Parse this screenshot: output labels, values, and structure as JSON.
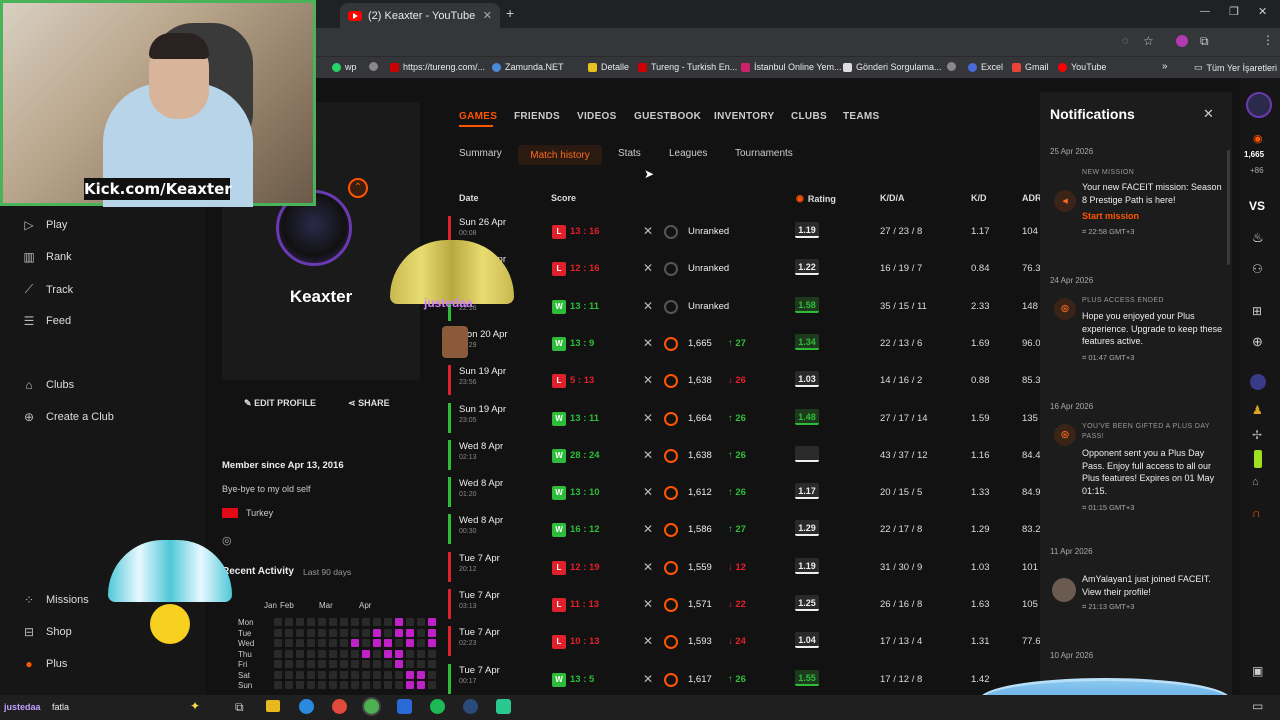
{
  "browser": {
    "tab_title": "(2) Keaxter - YouTube",
    "bookmarks": [
      "wp",
      "https://tureng.com/...",
      "Zamunda.NET",
      "Detalle",
      "Tureng - Turkish En...",
      "İstanbul Online Yem...",
      "Gönderi Sorgulama...",
      "Excel",
      "Gmail",
      "YouTube",
      "Tüm Yer İşaretleri"
    ]
  },
  "webcam": {
    "label": "Kick.com/Keaxter"
  },
  "sidenav": {
    "items": [
      "Play",
      "Rank",
      "Track",
      "Feed",
      "Clubs",
      "Create a Club",
      "Missions",
      "Shop",
      "Plus"
    ]
  },
  "profile": {
    "name": "Keaxter",
    "edit_label": "EDIT PROFILE",
    "share_label": "SHARE",
    "member_since": "Member since Apr 13, 2016",
    "bio": "Bye-bye to my old self",
    "country": "Turkey",
    "recent_activity": "Recent Activity",
    "recent_period": "Last 90 days",
    "months": [
      "Jan",
      "Feb",
      "Mar",
      "Apr"
    ],
    "days": [
      "Mon",
      "Tue",
      "Wed",
      "Thu",
      "Fri",
      "Sat",
      "Sun"
    ]
  },
  "overlays": {
    "parachute_user": "justedaa",
    "chat_user": "justedaa",
    "chat_text": "fatla"
  },
  "tabs": [
    "GAMES",
    "FRIENDS",
    "VIDEOS",
    "GUESTBOOK",
    "INVENTORY",
    "CLUBS",
    "TEAMS"
  ],
  "subtabs": [
    "Summary",
    "Match history",
    "Stats",
    "Leagues",
    "Tournaments"
  ],
  "table": {
    "headers": [
      "Date",
      "Score",
      "Rating",
      "K/D/A",
      "K/D",
      "ADR"
    ],
    "rows": [
      {
        "date": "Sun 26 Apr",
        "time": "00:08",
        "result": "L",
        "score": "13 : 16",
        "rank": "Unranked",
        "change": "",
        "rating": "1.19",
        "kda": "27 / 23 / 8",
        "kd": "1.17",
        "adr": "104"
      },
      {
        "date": "Sun 26 Apr",
        "time": "",
        "result": "L",
        "score": "12 : 16",
        "rank": "Unranked",
        "change": "",
        "rating": "1.22",
        "kda": "16 / 19 / 7",
        "kd": "0.84",
        "adr": "76.3"
      },
      {
        "date": "Sun 25 Apr",
        "time": "22:16",
        "result": "W",
        "score": "13 : 11",
        "rank": "Unranked",
        "change": "",
        "rating": "1.58",
        "kda": "35 / 15 / 11",
        "kd": "2.33",
        "adr": "148"
      },
      {
        "date": "Mon 20 Apr",
        "time": "00:29",
        "result": "W",
        "score": "13 : 9",
        "rank": "1,665",
        "change": "27",
        "rating": "1.34",
        "kda": "22 / 13 / 6",
        "kd": "1.69",
        "adr": "96.0"
      },
      {
        "date": "Sun 19 Apr",
        "time": "23:56",
        "result": "L",
        "score": "5 : 13",
        "rank": "1,638",
        "change": "26",
        "rating": "1.03",
        "kda": "14 / 16 / 2",
        "kd": "0.88",
        "adr": "85.3"
      },
      {
        "date": "Sun 19 Apr",
        "time": "23:05",
        "result": "W",
        "score": "13 : 11",
        "rank": "1,664",
        "change": "26",
        "rating": "1.48",
        "kda": "27 / 17 / 14",
        "kd": "1.59",
        "adr": "135"
      },
      {
        "date": "Wed 8 Apr",
        "time": "02:13",
        "result": "W",
        "score": "28 : 24",
        "rank": "1,638",
        "change": "26",
        "rating": "",
        "kda": "43 / 37 / 12",
        "kd": "1.16",
        "adr": "84.4"
      },
      {
        "date": "Wed 8 Apr",
        "time": "01:20",
        "result": "W",
        "score": "13 : 10",
        "rank": "1,612",
        "change": "26",
        "rating": "1.17",
        "kda": "20 / 15 / 5",
        "kd": "1.33",
        "adr": "84.9"
      },
      {
        "date": "Wed 8 Apr",
        "time": "00:30",
        "result": "W",
        "score": "16 : 12",
        "rank": "1,586",
        "change": "27",
        "rating": "1.29",
        "kda": "22 / 17 / 8",
        "kd": "1.29",
        "adr": "83.2"
      },
      {
        "date": "Tue 7 Apr",
        "time": "20:12",
        "result": "L",
        "score": "12 : 19",
        "rank": "1,559",
        "change": "12",
        "rating": "1.19",
        "kda": "31 / 30 / 9",
        "kd": "1.03",
        "adr": "101"
      },
      {
        "date": "Tue 7 Apr",
        "time": "03:13",
        "result": "L",
        "score": "11 : 13",
        "rank": "1,571",
        "change": "22",
        "rating": "1.25",
        "kda": "26 / 16 / 8",
        "kd": "1.63",
        "adr": "105"
      },
      {
        "date": "Tue 7 Apr",
        "time": "02:23",
        "result": "L",
        "score": "10 : 13",
        "rank": "1,593",
        "change": "24",
        "rating": "1.04",
        "kda": "17 / 13 / 4",
        "kd": "1.31",
        "adr": "77.6"
      },
      {
        "date": "Tue 7 Apr",
        "time": "00:17",
        "result": "W",
        "score": "13 : 5",
        "rank": "1,617",
        "change": "26",
        "rating": "1.55",
        "kda": "17 / 12 / 8",
        "kd": "1.42",
        "adr": ""
      }
    ]
  },
  "notifications": {
    "title": "Notifications",
    "items": [
      {
        "date": "25 Apr 2026",
        "tag": "NEW MISSION",
        "text": "Your new FACEIT mission: Season 8 Prestige Path is here!",
        "action": "Start mission",
        "time": "22:58 GMT+3"
      },
      {
        "date": "24 Apr 2026",
        "tag": "PLUS ACCESS ENDED",
        "text": "Hope you enjoyed your Plus experience. Upgrade to keep these features active.",
        "action": "",
        "time": "01:47 GMT+3"
      },
      {
        "date": "16 Apr 2026",
        "tag": "YOU'VE BEEN GIFTED A PLUS DAY PASS!",
        "text": "Opponent sent you a Plus Day Pass. Enjoy full access to all our Plus features! Expires on 01 May 01:15.",
        "action": "",
        "time": "01:15 GMT+3"
      },
      {
        "date": "11 Apr 2026",
        "tag": "",
        "text": "AmYalayan1 just joined FACEIT. View their profile!",
        "action": "",
        "time": "21:13 GMT+3"
      },
      {
        "date": "10 Apr 2026",
        "tag": "",
        "text": "",
        "action": "",
        "time": ""
      }
    ]
  },
  "rail": {
    "elo": "1,665",
    "delta": "+86",
    "vs": "VS"
  },
  "colors": {
    "accent": "#ff5500",
    "win": "#2ebd3a",
    "loss": "#e0202a",
    "bg": "#121212"
  }
}
